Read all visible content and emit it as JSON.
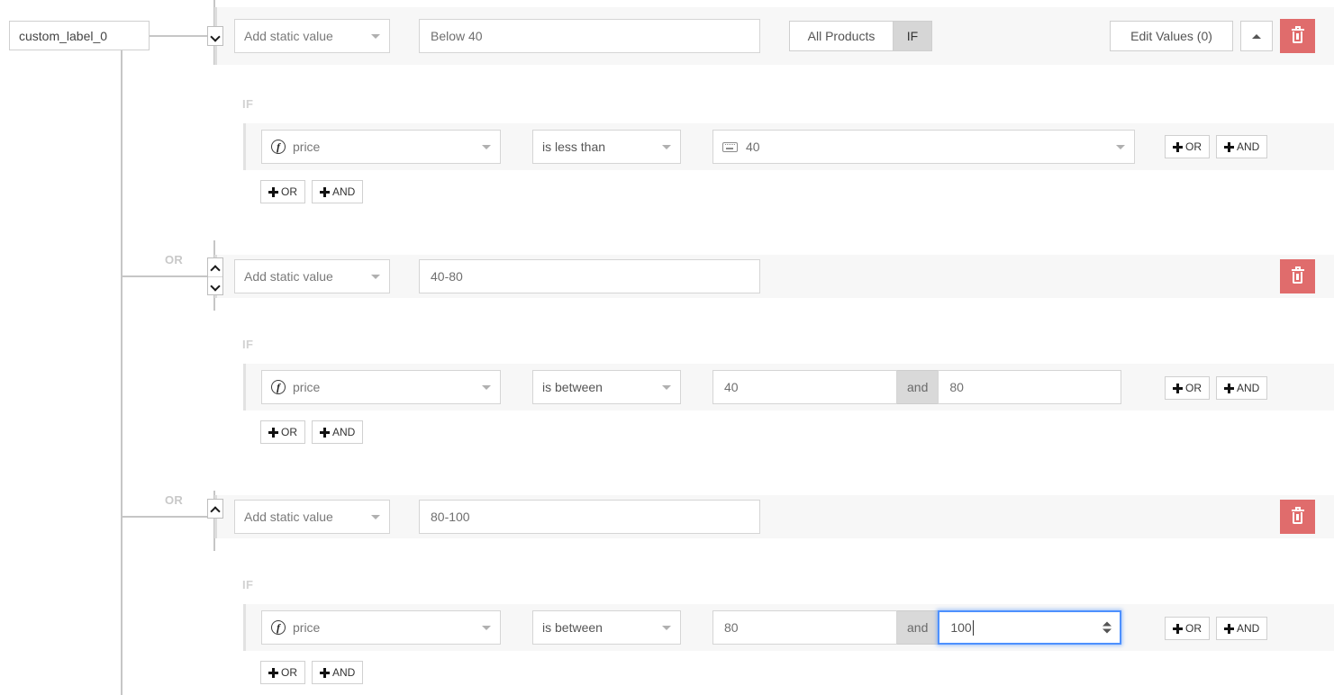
{
  "label_box": {
    "text": "custom_label_0"
  },
  "groups": [
    {
      "spinner": "down",
      "or_tag": null,
      "value_source": "Add static value",
      "static_value": "Below 40",
      "toggle": {
        "left": "All Products",
        "right": "IF",
        "active": "right"
      },
      "edit_values": "Edit Values (0)",
      "collapse_icon": "chevron-up-icon",
      "delete_icon": "trash-icon",
      "condition_label": "IF",
      "conditions": [
        {
          "field": "price",
          "field_icon": "function-icon",
          "operator": "is less than",
          "value_icon": "keyboard-icon",
          "value": "40",
          "value_type": "single",
          "or_button": "OR",
          "and_button": "AND"
        }
      ],
      "add_or": "OR",
      "add_and": "AND"
    },
    {
      "spinner": "both",
      "or_tag": "OR",
      "value_source": "Add static value",
      "static_value": "40-80",
      "toggle": null,
      "edit_values": null,
      "collapse_icon": null,
      "delete_icon": "trash-icon",
      "condition_label": "IF",
      "conditions": [
        {
          "field": "price",
          "field_icon": "function-icon",
          "operator": "is between",
          "value_icon": null,
          "value": "40",
          "value2": "80",
          "and_separator": "and",
          "value_type": "between",
          "focused": false,
          "or_button": "OR",
          "and_button": "AND"
        }
      ],
      "add_or": "OR",
      "add_and": "AND"
    },
    {
      "spinner": "up",
      "or_tag": "OR",
      "value_source": "Add static value",
      "static_value": "80-100",
      "toggle": null,
      "edit_values": null,
      "collapse_icon": null,
      "delete_icon": "trash-icon",
      "condition_label": "IF",
      "conditions": [
        {
          "field": "price",
          "field_icon": "function-icon",
          "operator": "is between",
          "value_icon": null,
          "value": "80",
          "value2": "100",
          "and_separator": "and",
          "value_type": "between",
          "focused": true,
          "or_button": "OR",
          "and_button": "AND"
        }
      ],
      "add_or": "OR",
      "add_and": "AND"
    }
  ],
  "colors": {
    "row_bg": "#f7f7f7",
    "tree_line": "#c6c6c6",
    "delete_red": "#e06c6c",
    "focus_blue": "#4d90fe",
    "toggle_active": "#d6d6d6",
    "and_sep_bg": "#d9d9d9"
  }
}
